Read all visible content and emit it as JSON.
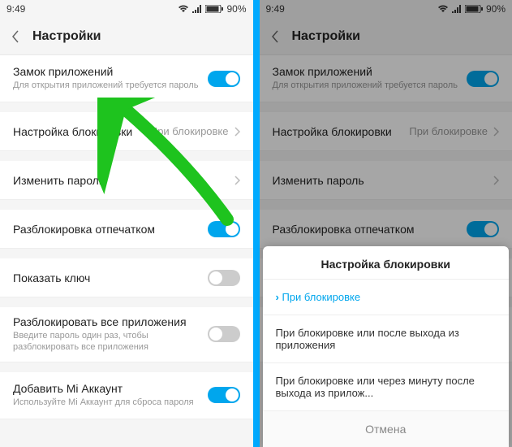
{
  "status": {
    "time": "9:49",
    "battery": "90%"
  },
  "header": {
    "title": "Настройки"
  },
  "rows": {
    "appLock": {
      "title": "Замок приложений",
      "sub": "Для открытия приложений требуется пароль"
    },
    "lockSetting": {
      "title": "Настройка блокировки",
      "value": "При блокировке"
    },
    "changePass": {
      "title": "Изменить пароль"
    },
    "fingerprint": {
      "title": "Разблокировка отпечатком"
    },
    "showKey": {
      "title": "Показать ключ"
    },
    "unlockAll": {
      "title": "Разблокировать все приложения",
      "sub": "Введите пароль один раз, чтобы разблокировать все приложения"
    },
    "miAccount": {
      "title": "Добавить Mi Аккаунт",
      "sub": "Используйте Mi Аккаунт для сброса пароля"
    }
  },
  "sheet": {
    "title": "Настройка блокировки",
    "opt1": "При блокировке",
    "opt2": "При блокировке или после выхода из приложения",
    "opt3": "При блокировке или через минуту после выхода из прилож...",
    "cancel": "Отмена"
  }
}
